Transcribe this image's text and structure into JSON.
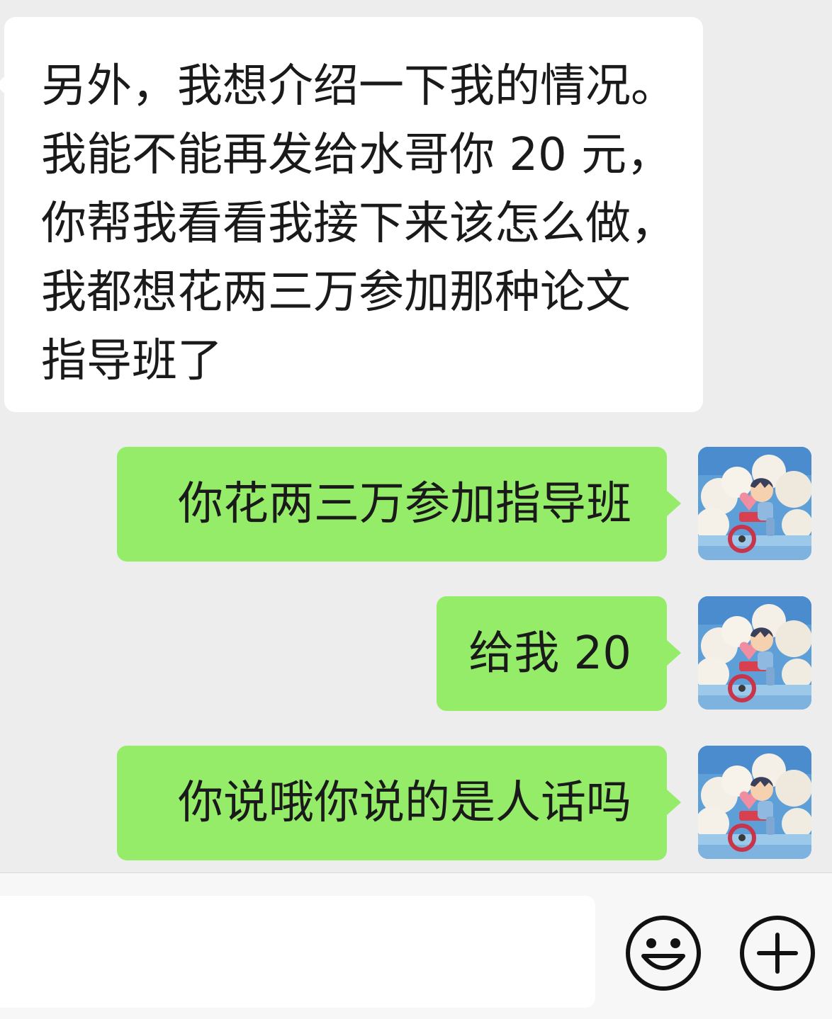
{
  "messages": [
    {
      "direction": "incoming",
      "lines": [
        "另外，我想介绍一下我的情况。",
        "我能不能再发给水哥你 20 元，",
        "你帮我看看我接下来该怎么做，",
        "我都想花两三万参加那种论文",
        "指导班了"
      ]
    },
    {
      "direction": "outgoing",
      "text": "你花两三万参加指导班"
    },
    {
      "direction": "outgoing",
      "text": "给我 20"
    },
    {
      "direction": "outgoing",
      "text": "你说哦你说的是人话吗"
    }
  ],
  "input": {
    "value": "",
    "placeholder": ""
  },
  "icons": {
    "emoji": "smiley-face-icon",
    "more": "plus-circle-icon",
    "avatar": "anime-boy-on-bicycle-avatar"
  },
  "colors": {
    "chat_background": "#ededed",
    "incoming_bubble": "#ffffff",
    "outgoing_bubble": "#95ec69",
    "input_bar": "#f7f7f7"
  }
}
